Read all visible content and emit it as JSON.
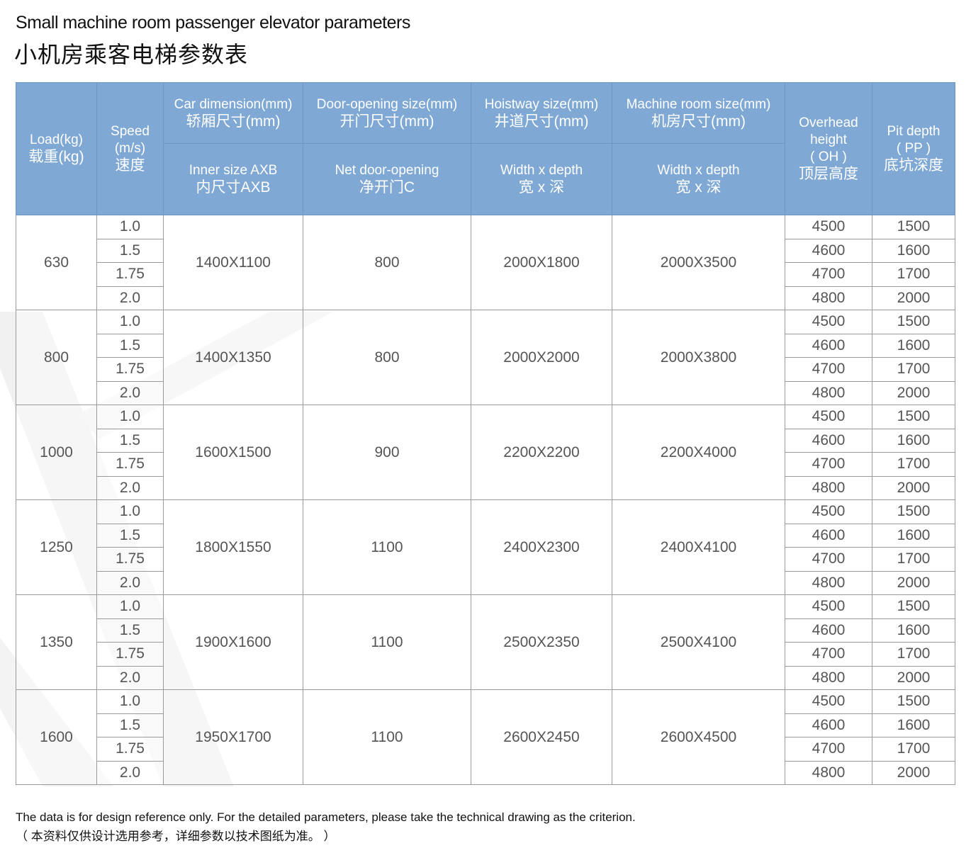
{
  "title_en": "Small machine room passenger elevator parameters",
  "title_cn": "小机房乘客电梯参数表",
  "headers": {
    "load": [
      "Load(kg)",
      "载重(kg)"
    ],
    "speed": [
      "Speed",
      "(m/s)",
      "速度"
    ],
    "car": [
      "Car dimension(mm)",
      "轿厢尺寸(mm)"
    ],
    "door": [
      "Door-opening size(mm)",
      "开门尺寸(mm)"
    ],
    "hoistway": [
      "Hoistway size(mm)",
      "井道尺寸(mm)"
    ],
    "machine": [
      "Machine room size(mm)",
      "机房尺寸(mm)"
    ],
    "overhead": [
      "Overhead",
      "height",
      "( OH )",
      "顶层高度"
    ],
    "pit": [
      "Pit depth",
      "( PP )",
      "底坑深度"
    ],
    "car_sub": [
      "Inner size AXB",
      "内尺寸AXB"
    ],
    "door_sub": [
      "Net door-opening",
      "净开门C"
    ],
    "hoistway_sub": [
      "Width x depth",
      "宽 x 深"
    ],
    "machine_sub": [
      "Width x depth",
      "宽 x 深"
    ]
  },
  "groups": [
    {
      "load": "630",
      "car": "1400X1100",
      "door": "800",
      "hoistway": "2000X1800",
      "machine": "2000X3500",
      "speeds": [
        "1.0",
        "1.5",
        "1.75",
        "2.0"
      ],
      "oh": [
        "4500",
        "4600",
        "4700",
        "4800"
      ],
      "pp": [
        "1500",
        "1600",
        "1700",
        "2000"
      ]
    },
    {
      "load": "800",
      "car": "1400X1350",
      "door": "800",
      "hoistway": "2000X2000",
      "machine": "2000X3800",
      "speeds": [
        "1.0",
        "1.5",
        "1.75",
        "2.0"
      ],
      "oh": [
        "4500",
        "4600",
        "4700",
        "4800"
      ],
      "pp": [
        "1500",
        "1600",
        "1700",
        "2000"
      ]
    },
    {
      "load": "1000",
      "car": "1600X1500",
      "door": "900",
      "hoistway": "2200X2200",
      "machine": "2200X4000",
      "speeds": [
        "1.0",
        "1.5",
        "1.75",
        "2.0"
      ],
      "oh": [
        "4500",
        "4600",
        "4700",
        "4800"
      ],
      "pp": [
        "1500",
        "1600",
        "1700",
        "2000"
      ]
    },
    {
      "load": "1250",
      "car": "1800X1550",
      "door": "1100",
      "hoistway": "2400X2300",
      "machine": "2400X4100",
      "speeds": [
        "1.0",
        "1.5",
        "1.75",
        "2.0"
      ],
      "oh": [
        "4500",
        "4600",
        "4700",
        "4800"
      ],
      "pp": [
        "1500",
        "1600",
        "1700",
        "2000"
      ]
    },
    {
      "load": "1350",
      "car": "1900X1600",
      "door": "1100",
      "hoistway": "2500X2350",
      "machine": "2500X4100",
      "speeds": [
        "1.0",
        "1.5",
        "1.75",
        "2.0"
      ],
      "oh": [
        "4500",
        "4600",
        "4700",
        "4800"
      ],
      "pp": [
        "1500",
        "1600",
        "1700",
        "2000"
      ]
    },
    {
      "load": "1600",
      "car": "1950X1700",
      "door": "1100",
      "hoistway": "2600X2450",
      "machine": "2600X4500",
      "speeds": [
        "1.0",
        "1.5",
        "1.75",
        "2.0"
      ],
      "oh": [
        "4500",
        "4600",
        "4700",
        "4800"
      ],
      "pp": [
        "1500",
        "1600",
        "1700",
        "2000"
      ]
    }
  ],
  "note_en": "The data is for design reference only.  For the detailed parameters, please take the technical drawing as the criterion.",
  "note_cn": "（ 本资料仅供设计选用参考，详细参数以技术图纸为准。 ）",
  "colors": {
    "header_bg": "#7fa8d4",
    "watermark": "#f0f0f0"
  }
}
